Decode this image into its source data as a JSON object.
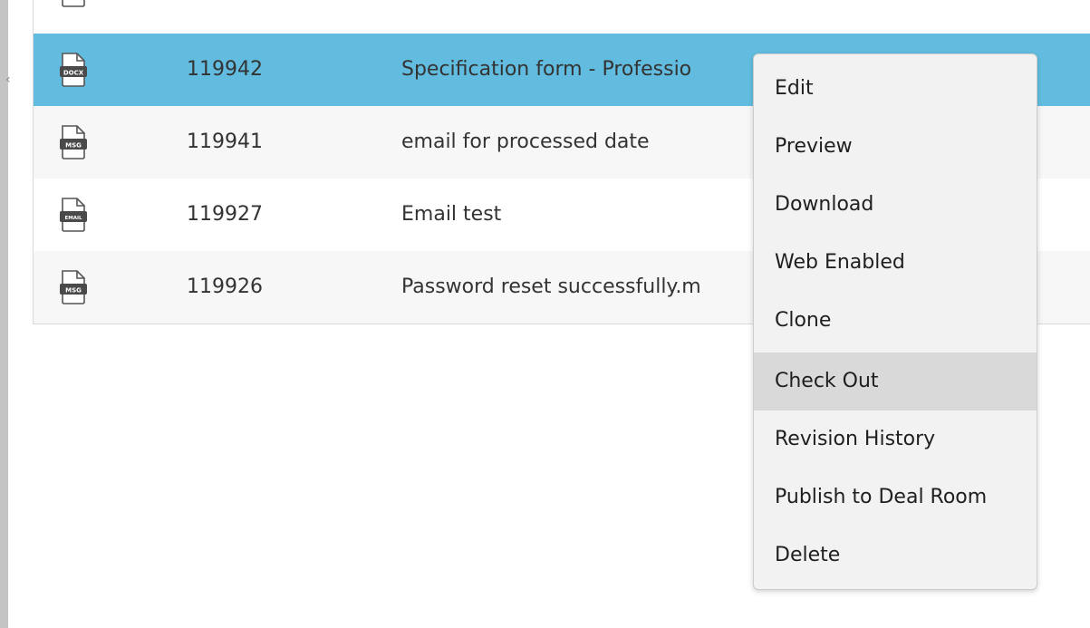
{
  "rows": [
    {
      "icon_badge": "DOCX",
      "id": "119942",
      "name": "Specification form - Professio",
      "selected": true
    },
    {
      "icon_badge": "MSG",
      "id": "119941",
      "name": "email for processed date",
      "selected": false
    },
    {
      "icon_badge": "EMAIL",
      "id": "119927",
      "name": "Email test",
      "selected": false
    },
    {
      "icon_badge": "MSG",
      "id": "119926",
      "name": "Password reset successfully.m",
      "selected": false
    }
  ],
  "context_menu": {
    "items": [
      {
        "label": "Edit"
      },
      {
        "label": "Preview"
      },
      {
        "label": "Download"
      },
      {
        "label": "Web Enabled"
      },
      {
        "label": "Clone"
      },
      {
        "label": "Check Out",
        "hovered": true
      },
      {
        "label": "Revision History"
      },
      {
        "label": "Publish to Deal Room"
      },
      {
        "label": "Delete"
      }
    ]
  },
  "colors": {
    "selected_row": "#62bcdf",
    "menu_background": "#f2f2f2",
    "menu_hover": "#d9d9d9"
  },
  "icons": {
    "file_icon": "file-document-icon"
  }
}
